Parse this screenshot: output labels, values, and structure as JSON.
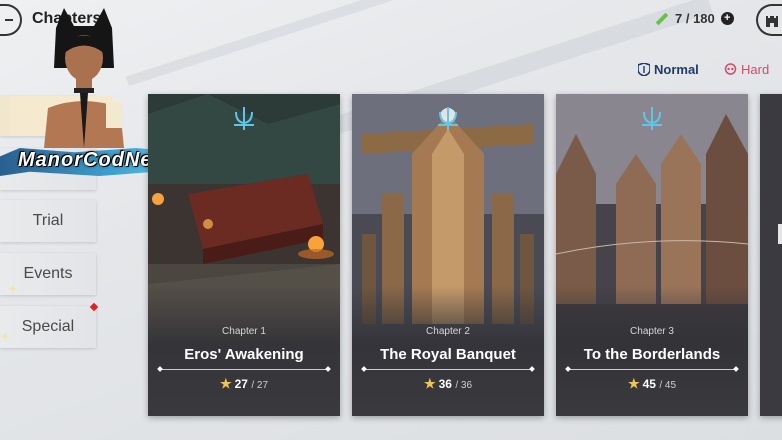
{
  "header": {
    "title": "Chapters",
    "stamina": "7 / 180"
  },
  "difficulty": {
    "normal_label": "Normal",
    "hard_label": "Hard",
    "selected": "Normal"
  },
  "sidebar": {
    "items": [
      {
        "label": ""
      },
      {
        "label": ""
      },
      {
        "label": "Trial"
      },
      {
        "label": "Events"
      },
      {
        "label": "Special"
      }
    ]
  },
  "overlay": {
    "streamer_name": "ManorCodNe"
  },
  "chapters": [
    {
      "chapter": "Chapter 1",
      "title": "Eros' Awakening",
      "stars": "27",
      "total": "/ 27"
    },
    {
      "chapter": "Chapter 2",
      "title": "The Royal Banquet",
      "stars": "36",
      "total": "/ 36"
    },
    {
      "chapter": "Chapter 3",
      "title": "To the Borderlands",
      "stars": "45",
      "total": "/ 45"
    }
  ],
  "colors": {
    "accent_normal": "#1f3b6b",
    "accent_hard": "#d54a68",
    "star": "#f0c454",
    "emblem": "#5fc6e8"
  },
  "icons": {
    "back": "back-arrow-icon",
    "stamina": "pencil-icon",
    "add": "plus-icon",
    "home": "castle-icon",
    "normal": "shield-icon",
    "hard": "skull-icon",
    "emblem": "trident-icon"
  }
}
